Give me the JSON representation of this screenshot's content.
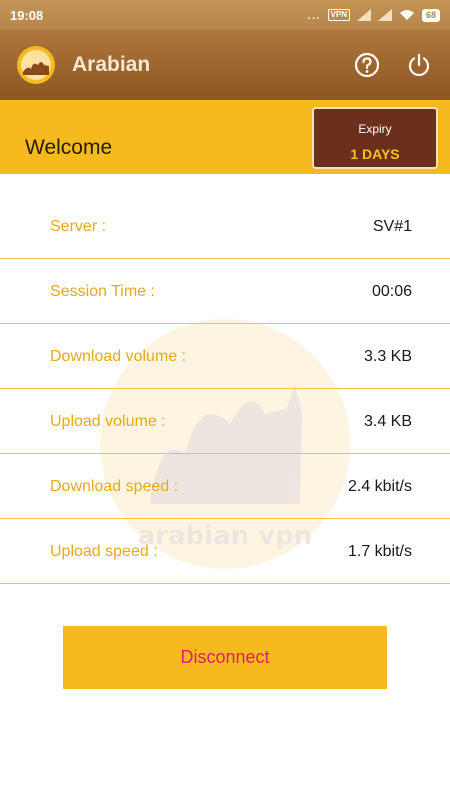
{
  "status_bar": {
    "time": "19:08",
    "dots": "...",
    "vpn_badge": "VPN",
    "battery": "68"
  },
  "app_bar": {
    "title": "Arabian",
    "help_icon": "help-circle-icon",
    "power_icon": "power-icon",
    "background": "#9a6630"
  },
  "welcome": {
    "title": "Welcome",
    "expiry_label": "Expiry",
    "expiry_value": "1 DAYS",
    "banner_color": "#f6b91e",
    "expiry_box_color": "#6b2f1c"
  },
  "info_rows": [
    {
      "label": "Server :",
      "value": "SV#1"
    },
    {
      "label": "Session Time :",
      "value": "00:06"
    },
    {
      "label": "Download volume :",
      "value": "3.3 KB"
    },
    {
      "label": "Upload volume :",
      "value": "3.4 KB"
    },
    {
      "label": "Download speed :",
      "value": "2.4 kbit/s"
    },
    {
      "label": "Upload speed :",
      "value": "1.7 kbit/s"
    }
  ],
  "disconnect": {
    "label": "Disconnect",
    "text_color": "#e21d6b"
  },
  "watermark_text": "arabian vpn"
}
